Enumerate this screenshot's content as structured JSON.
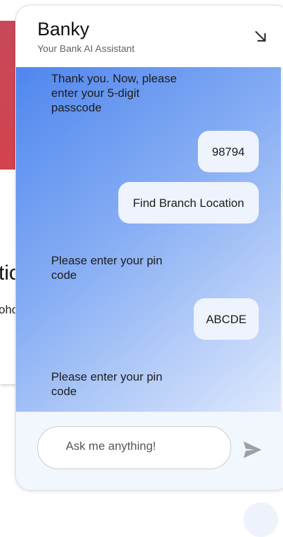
{
  "background": {
    "heading_fragment": "tic",
    "sub_fragment": "ohc"
  },
  "chat": {
    "title": "Banky",
    "subtitle": "Your Bank AI Assistant",
    "minimize_icon": "arrow-down-right-icon",
    "messages": [
      {
        "sender": "bot",
        "text": "Thank you. Now, please enter your 5-digit passcode"
      },
      {
        "sender": "user",
        "text": "98794"
      },
      {
        "sender": "user",
        "text": "Find Branch Location"
      },
      {
        "sender": "bot",
        "text": "Please enter your pin code"
      },
      {
        "sender": "user",
        "text": "ABCDE"
      },
      {
        "sender": "bot",
        "text": "Please enter your pin code"
      }
    ],
    "input": {
      "placeholder": "Ask me anything!",
      "value": ""
    },
    "send_icon": "send-icon"
  },
  "colors": {
    "gradient_start": "#4f86ee",
    "gradient_end": "#dde8fc",
    "user_bubble": "#eef3fd",
    "send_icon": "#9aa0a6",
    "banner_red": "#d2434d"
  }
}
